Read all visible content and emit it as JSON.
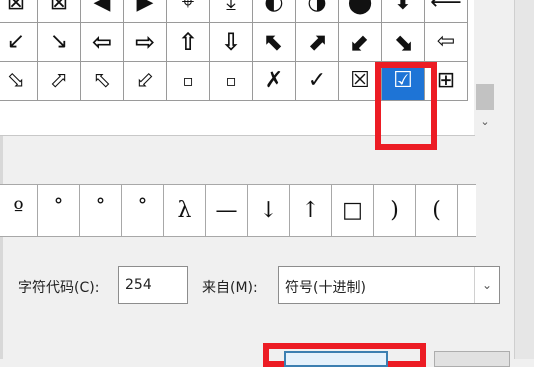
{
  "symbol_grid": {
    "rows": [
      [
        "⊠",
        "⊠",
        "◀",
        "▶",
        "⌖",
        "⤓",
        "◐",
        "◑",
        "⬤",
        "⬇",
        "⟵"
      ],
      [
        "↙",
        "↘",
        "⇦",
        "⇨",
        "⇧",
        "⇩",
        "⬉",
        "⬈",
        "⬋",
        "⬊",
        "⇦"
      ],
      [
        "⬂",
        "⬀",
        "⬁",
        "⬃",
        "▫",
        "▫",
        "✗",
        "✓",
        "☒",
        "☑",
        "⊞"
      ]
    ],
    "selected": {
      "row": 2,
      "col": 9
    }
  },
  "recent_symbols": [
    "º",
    "˚",
    "˚",
    "˚",
    "λ",
    "—",
    "↓",
    "↑",
    "□",
    ")",
    "("
  ],
  "char_code": {
    "label": "字符代码(C):",
    "value": "254"
  },
  "from": {
    "label": "来自(M):",
    "value": "符号(十进制)"
  },
  "colors": {
    "highlight_red": "#ec1c24",
    "selected_blue": "#1e74d6"
  }
}
